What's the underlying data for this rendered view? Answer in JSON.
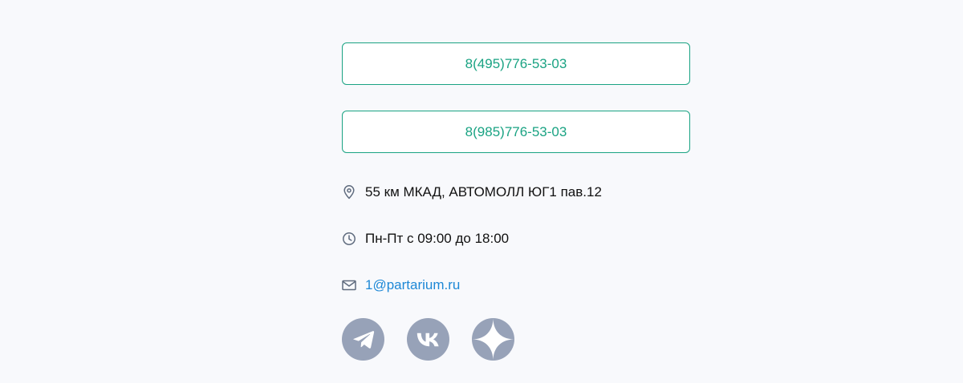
{
  "contacts": {
    "phones": [
      "8(495)776-53-03",
      "8(985)776-53-03"
    ],
    "address": "55 км МКАД, АВТОМОЛЛ ЮГ1 пав.12",
    "hours": "Пн-Пт с 09:00 до 18:00",
    "email": "1@partarium.ru"
  },
  "icons": {
    "address": "location-pin-icon",
    "hours": "clock-icon",
    "email": "mail-icon"
  },
  "socials": [
    {
      "name": "telegram-icon"
    },
    {
      "name": "vk-icon"
    },
    {
      "name": "yandex-zen-icon"
    }
  ],
  "colors": {
    "accent": "#1aa383",
    "link": "#1e88d6",
    "icon_bg": "#97a2b8",
    "text": "#111111",
    "background": "#f8f9fc"
  }
}
